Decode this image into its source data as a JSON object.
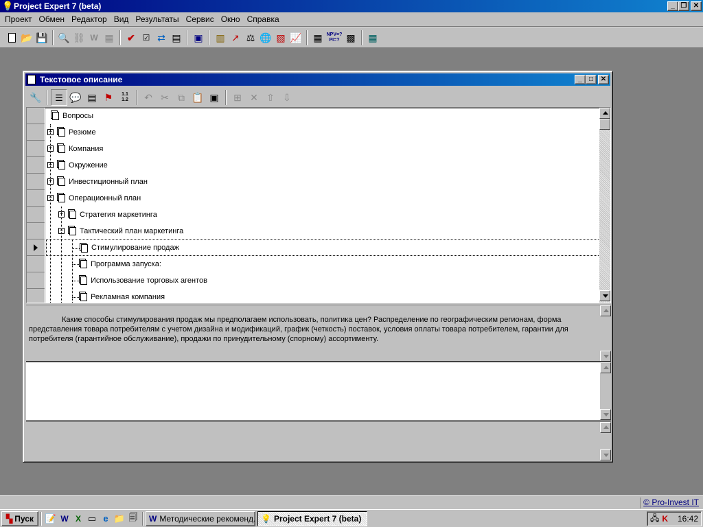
{
  "app": {
    "title": "Project Expert 7 (beta)",
    "icon": "lightbulb-icon"
  },
  "menu": [
    {
      "label": "Проект"
    },
    {
      "label": "Обмен"
    },
    {
      "label": "Редактор"
    },
    {
      "label": "Вид"
    },
    {
      "label": "Результаты"
    },
    {
      "label": "Сервис"
    },
    {
      "label": "Окно"
    },
    {
      "label": "Справка"
    }
  ],
  "toolbar": {
    "items": [
      {
        "name": "new-document-icon"
      },
      {
        "name": "open-folder-icon"
      },
      {
        "name": "save-icon"
      },
      {
        "name": "print-preview-icon"
      },
      {
        "name": "link-icon"
      },
      {
        "name": "word-export-icon"
      },
      {
        "name": "spreadsheet-export-icon"
      },
      {
        "name": "check-icon"
      },
      {
        "name": "checkbox-list-icon"
      },
      {
        "name": "recalculate-icon"
      },
      {
        "name": "calculator-icon"
      },
      {
        "name": "monitor-icon"
      },
      {
        "name": "report-icon"
      },
      {
        "name": "cash-flow-icon"
      },
      {
        "name": "balance-scales-icon"
      },
      {
        "name": "globe-icon"
      },
      {
        "name": "table-icon"
      },
      {
        "name": "chart-icon"
      },
      {
        "name": "matrix-icon"
      },
      {
        "name": "npv-pi-icon"
      },
      {
        "name": "analysis-icon"
      },
      {
        "name": "calendar-icon"
      }
    ],
    "npv_text": "NPV=?",
    "pi_text": "PI=?"
  },
  "child_window": {
    "title": "Текстовое описание",
    "toolbar_icons": [
      "wrench-icon",
      "outline-icon",
      "comment-icon",
      "text-block-icon",
      "bookmark-icon",
      "numbering-icon",
      "undo-icon",
      "cut-icon",
      "copy-icon",
      "paste-icon",
      "format-icon",
      "insert-icon",
      "delete-icon",
      "move-up-icon",
      "move-down-icon"
    ],
    "numbering_text_1": "1.1",
    "numbering_text_2": "1.2"
  },
  "tree": {
    "rows": [
      {
        "label": "Вопросы",
        "level": 0,
        "expander": ""
      },
      {
        "label": "Резюме",
        "level": 1,
        "expander": "+"
      },
      {
        "label": "Компания",
        "level": 1,
        "expander": "+"
      },
      {
        "label": "Окружение",
        "level": 1,
        "expander": "+"
      },
      {
        "label": "Инвестиционный план",
        "level": 1,
        "expander": "+"
      },
      {
        "label": "Операционный план",
        "level": 1,
        "expander": "-"
      },
      {
        "label": "Стратегия маркетинга",
        "level": 2,
        "expander": "+"
      },
      {
        "label": "Тактический план маркетинга",
        "level": 2,
        "expander": "-"
      },
      {
        "label": "Стимулирование продаж",
        "level": 3,
        "expander": "",
        "current": true
      },
      {
        "label": "Программа запуска:",
        "level": 3,
        "expander": ""
      },
      {
        "label": "Использование торговых агентов",
        "level": 3,
        "expander": ""
      },
      {
        "label": "Рекламная компания",
        "level": 3,
        "expander": ""
      }
    ]
  },
  "question": {
    "text": "Какие способы стимулирования продаж мы предполагаем использовать, политика цен? Распределение по географическим регионам, форма представления товара потребителям с учетом дизайна и модификаций, график (четкость) поставок, условия оплаты товара потребителем, гарантии для потребителя (гарантийное обслуживание), продажи по принудительному (спорному) ассортименту."
  },
  "answer": {
    "text": ""
  },
  "statusbar": {
    "link": "© Pro-Invest IT"
  },
  "taskbar": {
    "start_label": "Пуск",
    "quick_launch": [
      "notepad-icon",
      "word-icon",
      "excel-icon",
      "terminal-icon",
      "internet-explorer-icon",
      "folder-tools-icon",
      "documents-icon"
    ],
    "tasks": [
      {
        "label": "Методические рекоменд...",
        "icon": "word-document-icon",
        "active": false
      },
      {
        "label": "Project Expert 7 (beta)",
        "icon": "lightbulb-icon",
        "active": true
      }
    ],
    "tray_icons": [
      "network-icon",
      "antivirus-icon"
    ],
    "clock": "16:42"
  },
  "colors": {
    "titlebar_start": "#000080",
    "titlebar_end": "#1084d0",
    "face": "#c0c0c0",
    "desktop": "#808080"
  }
}
